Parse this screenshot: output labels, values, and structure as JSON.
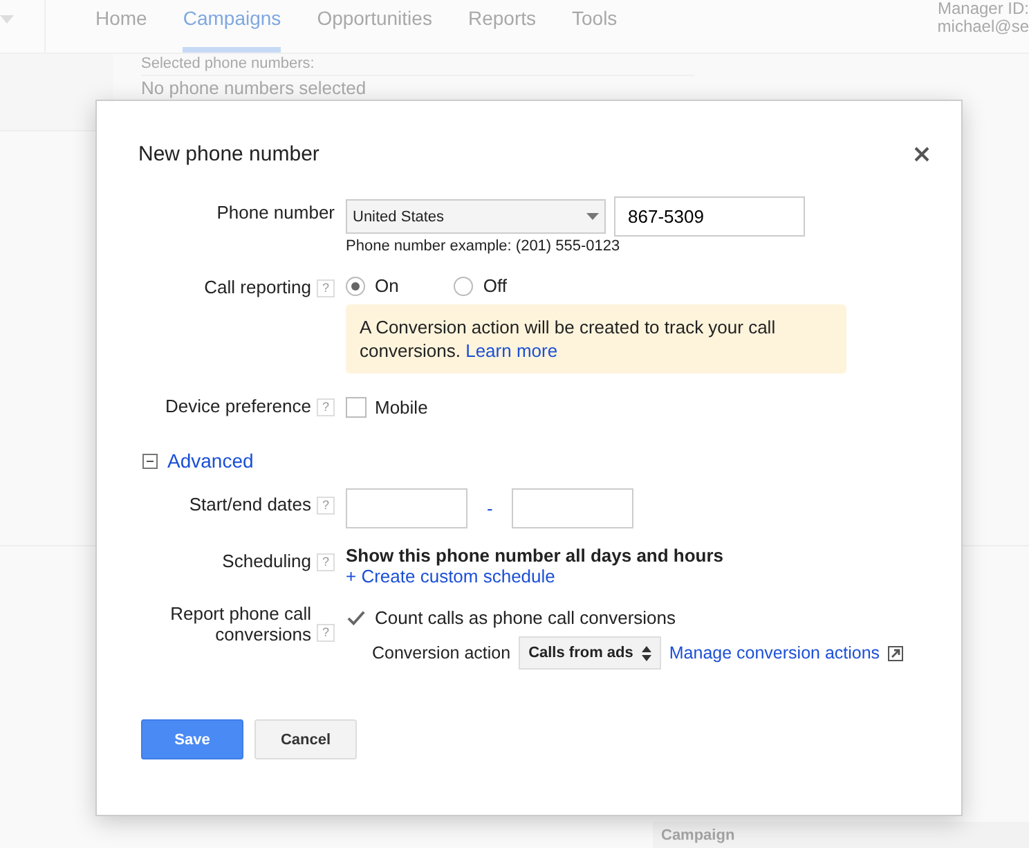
{
  "nav": {
    "tabs": [
      {
        "label": "Home",
        "selected": false
      },
      {
        "label": "Campaigns",
        "selected": true
      },
      {
        "label": "Opportunities",
        "selected": false
      },
      {
        "label": "Reports",
        "selected": false
      },
      {
        "label": "Tools",
        "selected": false
      }
    ],
    "account": {
      "manager": "Manager ID:",
      "email": "michael@se"
    }
  },
  "background": {
    "selected_label": "Selected phone numbers:",
    "empty_text": "No phone numbers selected",
    "column_header": "Campaign"
  },
  "dialog": {
    "title": "New phone number",
    "phone": {
      "label": "Phone number",
      "country": "United States",
      "number": "867-5309",
      "example": "Phone number example: (201) 555-0123"
    },
    "call_reporting": {
      "label": "Call reporting",
      "help": "?",
      "options": [
        {
          "label": "On",
          "selected": true
        },
        {
          "label": "Off",
          "selected": false
        }
      ],
      "notice": "A Conversion action will be created to track your call conversions.",
      "notice_link": "Learn more"
    },
    "device": {
      "label": "Device preference",
      "help": "?",
      "option": "Mobile",
      "checked": false
    },
    "advanced": {
      "label": "Advanced",
      "expanded": true
    },
    "dates": {
      "label": "Start/end dates",
      "help": "?",
      "separator": "-"
    },
    "scheduling": {
      "label": "Scheduling",
      "help": "?",
      "text": "Show this phone number all days and hours",
      "link": "+ Create custom schedule"
    },
    "report": {
      "label": "Report phone call conversions",
      "help": "?",
      "option": "Count calls as phone call conversions",
      "checked": true,
      "action_label": "Conversion action",
      "action_value": "Calls from ads",
      "manage_link": "Manage conversion actions"
    },
    "buttons": [
      {
        "label": "Save",
        "kind": "primary"
      },
      {
        "label": "Cancel",
        "kind": "secondary"
      }
    ]
  }
}
